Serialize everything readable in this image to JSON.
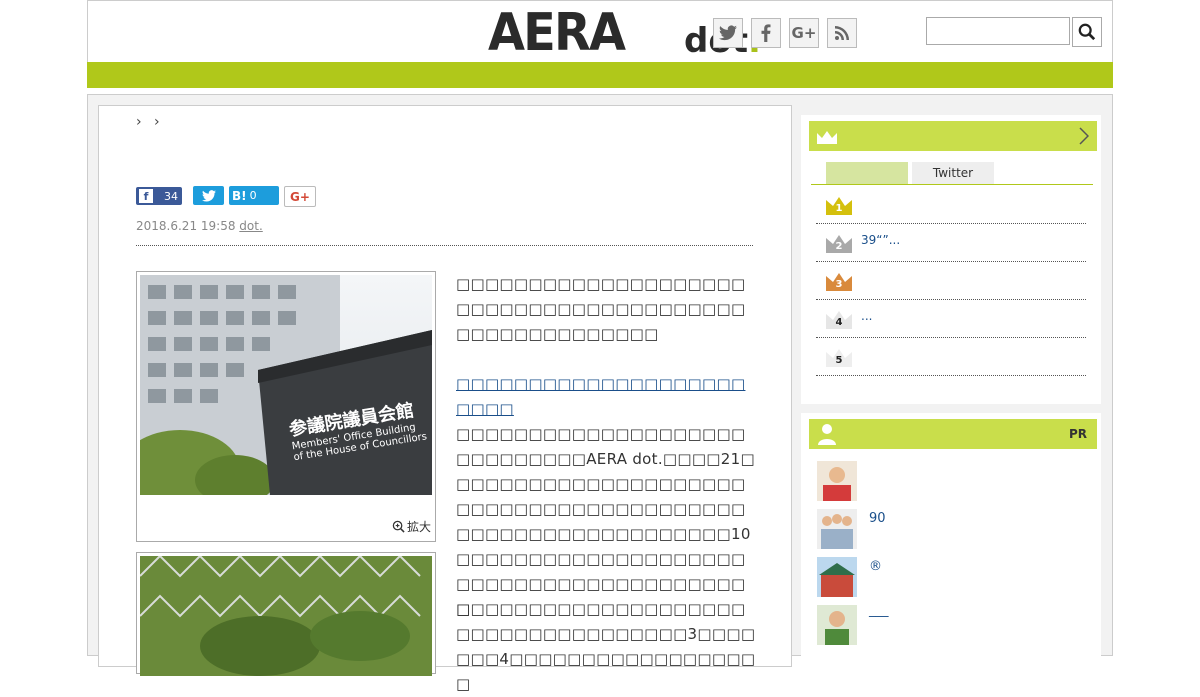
{
  "header": {
    "logo_main": "AERA",
    "logo_sub": "dot",
    "logo_period": ".",
    "search_placeholder": "",
    "social": [
      "twitter-icon",
      "facebook-icon",
      "google-plus-icon",
      "rss-icon"
    ]
  },
  "colors": {
    "brand_green": "#b0c81a",
    "head_green": "#c9de4b",
    "link_blue": "#1a4f8a"
  },
  "breadcrumb": [
    "›",
    "›"
  ],
  "share": {
    "facebook_count": "34",
    "hatena_label": "B!",
    "hatena_count": "0",
    "gplus_label": "G+"
  },
  "article": {
    "date": "2018.6.21 19:58",
    "author": "dot.",
    "zoom_label": "拡大",
    "photo_sign_jp": "参議院議員会館",
    "photo_sign_en1": "Members' Office Building",
    "photo_sign_en2": "of the House of Councillors",
    "para1": "□□□□□□□□□□□□□□□□□□□□□□□□□□□□□□□□□□□□□□□□□□□□□□□□□□□□□□",
    "link_text": "□□□□□□□□□□□□□□□□□□□□□□□□",
    "para2": "□□□□□□□□□□□□□□□□□□□□□□□□□□□□□AERA dot.□□□□21□□□□□□□□□□□□□□□□□□□□□□□□□□□□□□□□□□□□□□□□□□□□□□□□□□□□□□□□□□□□10□□□□□□□□□□□□□□□□□□□□□□□□□□□□□□□□□□□□□□□□□",
    "para3": "□□□□□□□□□□□□□□□□□□□□□□□□□□□□□□□□□□□□3□□□□□□□4□□□□□□□□□□□□□□□□□□"
  },
  "sidebar": {
    "tabs": [
      "",
      "Twitter"
    ],
    "ranking": [
      {
        "rank": "1",
        "text": ""
      },
      {
        "rank": "2",
        "text": "39“”..."
      },
      {
        "rank": "3",
        "text": ""
      },
      {
        "rank": "4",
        "text": "..."
      },
      {
        "rank": "5",
        "text": ""
      }
    ],
    "pr_label": "PR",
    "pr_items": [
      {
        "text": ""
      },
      {
        "text": "90"
      },
      {
        "text": "®"
      },
      {
        "text": "___"
      }
    ]
  }
}
